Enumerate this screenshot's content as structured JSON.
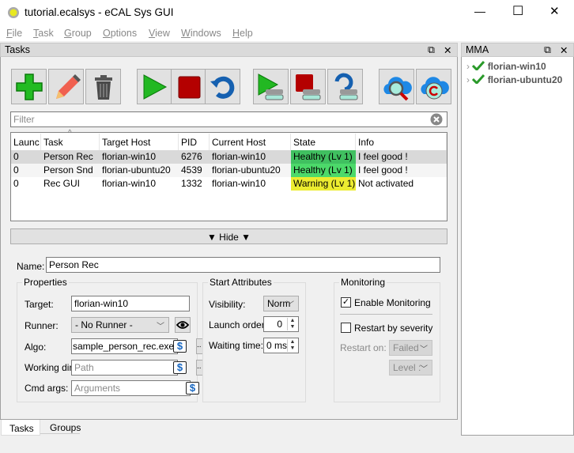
{
  "window": {
    "title": "tutorial.ecalsys - eCAL Sys GUI",
    "minimize": "—",
    "maximize": "☐",
    "close": "✕"
  },
  "menu": [
    "File",
    "Task",
    "Group",
    "Options",
    "View",
    "Windows",
    "Help"
  ],
  "tasks_dock": {
    "title": "Tasks",
    "float": "⧉",
    "close": "✕"
  },
  "mma_dock": {
    "title": "MMA",
    "float": "⧉",
    "close": "✕",
    "hosts": [
      {
        "name": "florian-win10",
        "status": "ok"
      },
      {
        "name": "florian-ubuntu20",
        "status": "ok"
      }
    ]
  },
  "toolbar": [
    "add-task",
    "edit-task",
    "remove-task",
    "start-task",
    "stop-task",
    "restart-task",
    "start-all",
    "stop-all",
    "restart-all",
    "search-hosts",
    "refresh-hosts"
  ],
  "filter": {
    "placeholder": "Filter"
  },
  "table": {
    "columns": [
      "Launc",
      "Task",
      "Target Host",
      "PID",
      "Current Host",
      "State",
      "Info"
    ],
    "sort_column": "Task",
    "rows": [
      {
        "launch": "0",
        "task": "Person Rec",
        "target": "florian-win10",
        "pid": "6276",
        "current": "florian-win10",
        "state": "Healthy (Lv 1)",
        "state_color": "#40c060",
        "info": "I feel good !",
        "selected": true
      },
      {
        "launch": "0",
        "task": "Person Snd",
        "target": "florian-ubuntu20",
        "pid": "4539",
        "current": "florian-ubuntu20",
        "state": "Healthy (Lv 1)",
        "state_color": "#4cd96a",
        "info": "I feel good !"
      },
      {
        "launch": "0",
        "task": "Rec GUI",
        "target": "florian-win10",
        "pid": "1332",
        "current": "florian-win10",
        "state": "Warning (Lv 1)",
        "state_color": "#ecec30",
        "info": "Not activated"
      }
    ]
  },
  "hide_button": "▼ Hide ▼",
  "details": {
    "name_label": "Name:",
    "name_value": "Person Rec",
    "properties": {
      "title": "Properties",
      "target_label": "Target:",
      "target_value": "florian-win10",
      "runner_label": "Runner:",
      "runner_value": "- No Runner -",
      "algo_label": "Algo:",
      "algo_value": "sample_person_rec.exe",
      "workdir_label": "Working dir:",
      "workdir_placeholder": "Path",
      "cmd_label": "Cmd args:",
      "cmd_placeholder": "Arguments",
      "browse": ".."
    },
    "start": {
      "title": "Start Attributes",
      "visibility_label": "Visibility:",
      "visibility_value": "Norm",
      "launch_label": "Launch order:",
      "launch_value": "0",
      "wait_label": "Waiting time:",
      "wait_value": "0 ms"
    },
    "monitoring": {
      "title": "Monitoring",
      "enable_label": "Enable Monitoring",
      "enable_checked": true,
      "restart_label": "Restart by severity",
      "restart_checked": false,
      "restart_on_label": "Restart on:",
      "restart_on_value": "Failed",
      "level_value": "Level :"
    }
  },
  "bottom_tabs": [
    "Tasks",
    "Groups"
  ]
}
